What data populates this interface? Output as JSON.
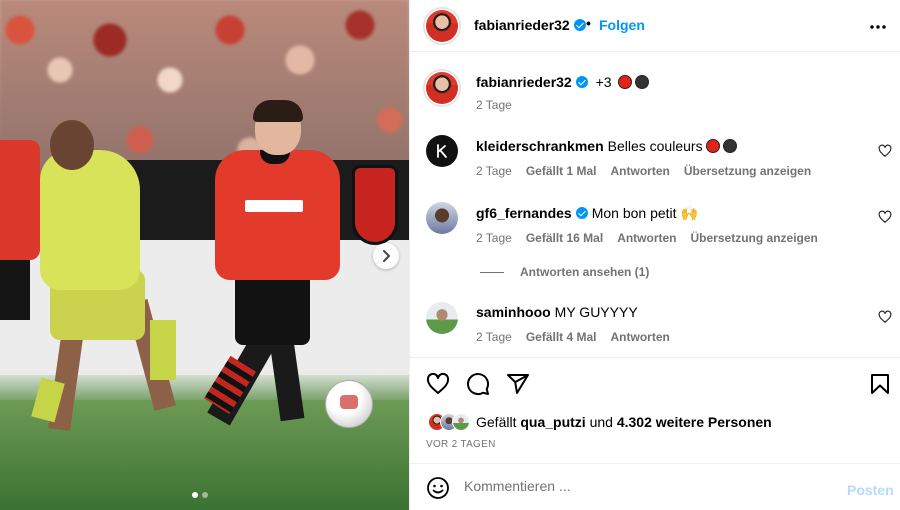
{
  "post": {
    "image_alt": "",
    "carousel": {
      "count": 2,
      "active": 1
    },
    "icons": {
      "next": "chevron-right-icon"
    }
  },
  "header": {
    "username": "fabianrieder32",
    "separator": "•",
    "follow_label": "Folgen",
    "icons": {
      "verified": "verified-icon",
      "more": "more-horizontal-icon"
    }
  },
  "caption": {
    "username": "fabianrieder32",
    "text": "+3",
    "emojis": [
      "red-circle",
      "black-circle"
    ],
    "time": "2 Tage"
  },
  "comments": [
    {
      "username": "kleiderschrankmen",
      "text": "Belles couleurs",
      "emojis": [
        "red-circle",
        "black-circle"
      ],
      "time": "2 Tage",
      "likes": "Gefällt 1 Mal",
      "reply": "Antworten",
      "translate": "Übersetzung anzeigen"
    },
    {
      "username": "gf6_fernandes",
      "verified": true,
      "text": "Mon bon petit",
      "emoji": "🙌",
      "time": "2 Tage",
      "likes": "Gefällt 16 Mal",
      "reply": "Antworten",
      "translate": "Übersetzung anzeigen",
      "view_replies": "Antworten ansehen (1)"
    },
    {
      "username": "saminhooo",
      "text": "MY GUYYYY",
      "time": "2 Tage",
      "likes": "Gefällt 4 Mal",
      "reply": "Antworten"
    }
  ],
  "actions": {
    "icons": [
      "heart-icon",
      "comment-icon",
      "share-icon",
      "bookmark-icon"
    ]
  },
  "likes": {
    "prefix": "Gefällt",
    "user": "qua_putzi",
    "connector": "und",
    "others": "4.302 weitere Personen"
  },
  "date": "VOR 2 TAGEN",
  "composer": {
    "placeholder": "Kommentieren ...",
    "post_label": "Posten",
    "icons": {
      "emoji": "emoji-icon"
    }
  },
  "colors": {
    "accent": "#0095f6",
    "post_disabled": "#b3dbff",
    "secondary_text": "#737373",
    "divider": "#efefef"
  }
}
